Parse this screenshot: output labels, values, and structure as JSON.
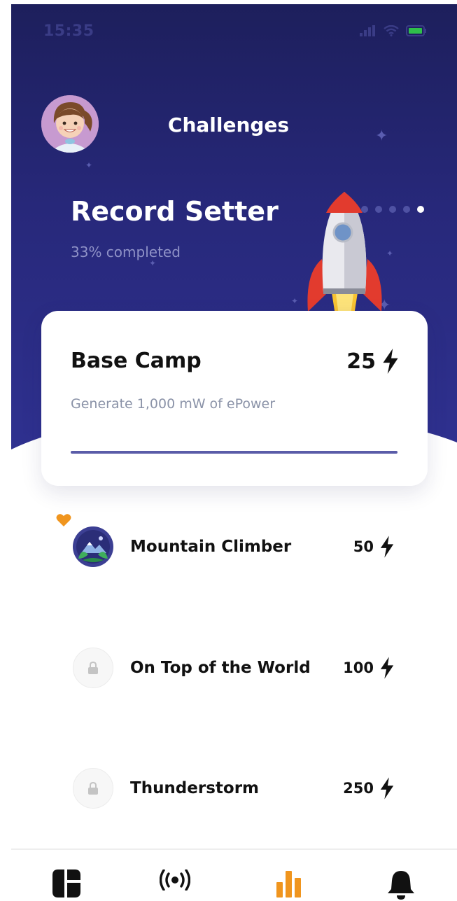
{
  "status_bar": {
    "time": "15:35"
  },
  "header": {
    "title": "Challenges"
  },
  "featured_challenge": {
    "title": "Record Setter",
    "progress_text": "33% completed",
    "progress_fraction": 0.33,
    "carousel": {
      "count": 5,
      "active_index": 4
    }
  },
  "current_task": {
    "title": "Base Camp",
    "points": "25",
    "description": "Generate 1,000 mW of ePower",
    "progress_fraction": 1.0
  },
  "challenges": [
    {
      "name": "Mountain Climber",
      "points": "50",
      "status": "unlocked",
      "icon": "mountain-badge-icon",
      "favorite": true
    },
    {
      "name": "On Top of the World",
      "points": "100",
      "status": "locked",
      "icon": "lock-icon"
    },
    {
      "name": "Thunderstorm",
      "points": "250",
      "status": "locked",
      "icon": "lock-icon"
    }
  ],
  "tabbar": {
    "items": [
      {
        "icon": "dashboard-icon"
      },
      {
        "icon": "broadcast-icon"
      },
      {
        "icon": "bar-chart-icon",
        "active": true
      },
      {
        "icon": "bell-icon"
      }
    ]
  },
  "colors": {
    "hero_bg": "#27287a",
    "accent": "#f0951e",
    "progress": "#5a5ca8",
    "text_primary": "#111111",
    "text_muted": "#8b93a8"
  }
}
